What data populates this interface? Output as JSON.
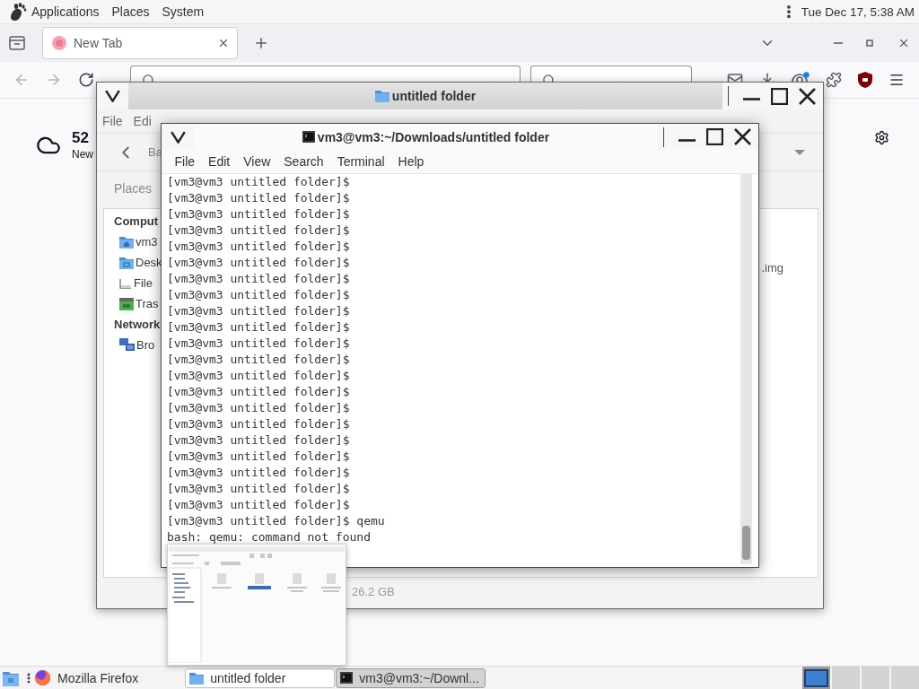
{
  "top_panel": {
    "menus": [
      "Applications",
      "Places",
      "System"
    ],
    "clock": "Tue Dec 17, 5:38 AM"
  },
  "browser": {
    "tabs": [
      {
        "title": "New Tab",
        "selected": true
      }
    ],
    "weather": {
      "temperature": "52",
      "location": "New"
    }
  },
  "file_manager": {
    "title": "untitled folder",
    "menus": [
      "File",
      "Edi"
    ],
    "back_button": "Ba",
    "side_pane_selector": "Places",
    "sidebar": [
      {
        "kind": "heading",
        "label": "Comput"
      },
      {
        "kind": "home",
        "label": "vm3"
      },
      {
        "kind": "desktop",
        "label": "Desk"
      },
      {
        "kind": "drive",
        "label": "File"
      },
      {
        "kind": "trash",
        "label": "Tras"
      },
      {
        "kind": "heading",
        "label": "Network"
      },
      {
        "kind": "network",
        "label": "Bro"
      }
    ],
    "file_name": ".img",
    "status_bar": "26.2 GB"
  },
  "terminal": {
    "title": "vm3@vm3:~/Downloads/untitled folder",
    "menus": [
      "File",
      "Edit",
      "View",
      "Search",
      "Terminal",
      "Help"
    ],
    "lines": [
      "[vm3@vm3 untitled folder]$",
      "[vm3@vm3 untitled folder]$",
      "[vm3@vm3 untitled folder]$",
      "[vm3@vm3 untitled folder]$",
      "[vm3@vm3 untitled folder]$",
      "[vm3@vm3 untitled folder]$",
      "[vm3@vm3 untitled folder]$",
      "[vm3@vm3 untitled folder]$",
      "[vm3@vm3 untitled folder]$",
      "[vm3@vm3 untitled folder]$",
      "[vm3@vm3 untitled folder]$",
      "[vm3@vm3 untitled folder]$",
      "[vm3@vm3 untitled folder]$",
      "[vm3@vm3 untitled folder]$",
      "[vm3@vm3 untitled folder]$",
      "[vm3@vm3 untitled folder]$",
      "[vm3@vm3 untitled folder]$",
      "[vm3@vm3 untitled folder]$",
      "[vm3@vm3 untitled folder]$",
      "[vm3@vm3 untitled folder]$",
      "[vm3@vm3 untitled folder]$",
      "[vm3@vm3 untitled folder]$ qemu",
      "bash: qemu: command not found"
    ]
  },
  "taskbar": {
    "launcher": "Mozilla Firefox",
    "windows": [
      {
        "kind": "folder",
        "title": "untitled folder",
        "selected": false
      },
      {
        "kind": "terminal",
        "title": "vm3@vm3:~/Downl...",
        "selected": true
      }
    ],
    "workspaces": [
      {
        "selected": true
      },
      {
        "selected": false
      },
      {
        "selected": false
      },
      {
        "selected": false
      }
    ]
  }
}
